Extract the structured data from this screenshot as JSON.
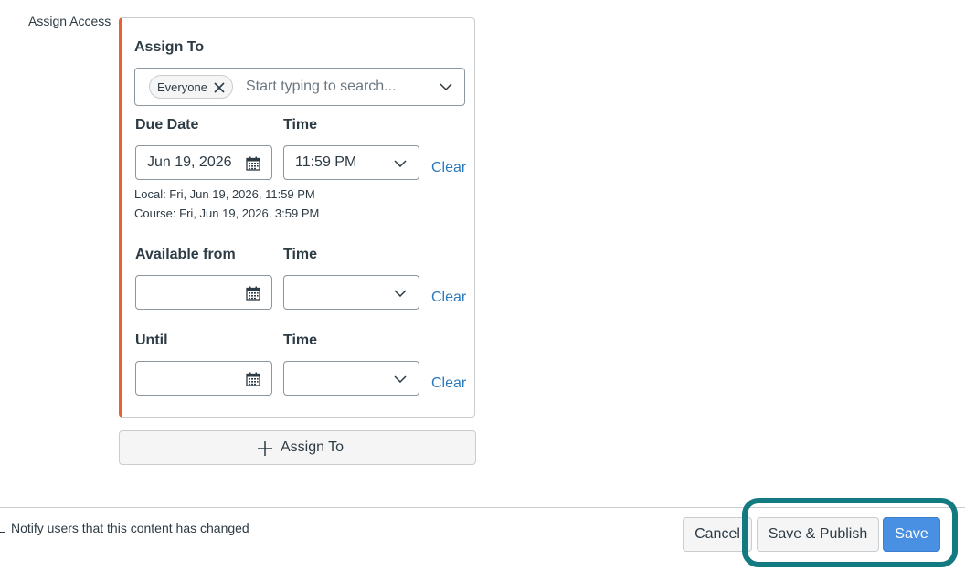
{
  "section_label": "Assign Access",
  "card": {
    "assign_to_heading": "Assign To",
    "assignee_chip": "Everyone",
    "search_placeholder": "Start typing to search...",
    "due": {
      "label": "Due Date",
      "time_label": "Time",
      "date_value": "Jun 19, 2026",
      "time_value": "11:59 PM",
      "clear_label": "Clear",
      "local_note": "Local: Fri, Jun 19, 2026, 11:59 PM",
      "course_note": "Course: Fri, Jun 19, 2026, 3:59 PM"
    },
    "available_from": {
      "label": "Available from",
      "time_label": "Time",
      "date_value": "",
      "time_value": "",
      "clear_label": "Clear"
    },
    "until": {
      "label": "Until",
      "time_label": "Time",
      "date_value": "",
      "time_value": "",
      "clear_label": "Clear"
    }
  },
  "add_assign_button": "Assign To",
  "footer": {
    "notify_label": "Notify users that this content has changed",
    "notify_checked": false,
    "cancel": "Cancel",
    "save_publish": "Save & Publish",
    "save": "Save"
  },
  "colors": {
    "card_accent": "#e66135",
    "link": "#2b7abc",
    "primary_button": "#4a90e2",
    "highlight_ring": "#137a82"
  },
  "icons": [
    "close-icon",
    "chevron-down-icon",
    "calendar-icon",
    "plus-icon"
  ]
}
